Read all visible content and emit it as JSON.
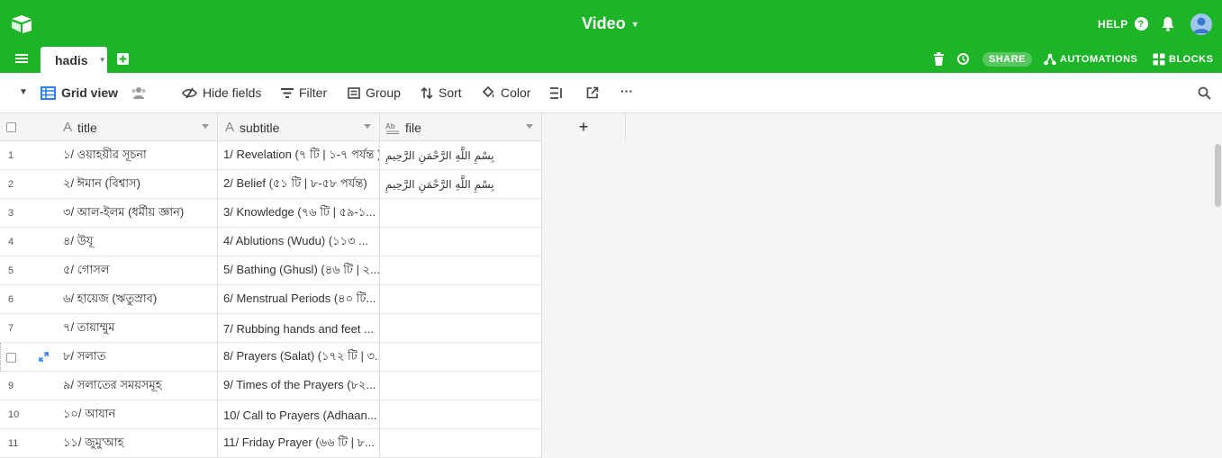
{
  "header": {
    "base_name": "Video",
    "help_label": "HELP",
    "share_label": "SHARE",
    "automations_label": "AUTOMATIONS",
    "blocks_label": "BLOCKS",
    "brand_color": "#1db428"
  },
  "tabs": [
    {
      "label": "hadis",
      "active": true
    }
  ],
  "viewbar": {
    "view_name": "Grid view",
    "hide_fields": "Hide fields",
    "filter": "Filter",
    "group": "Group",
    "sort": "Sort",
    "color": "Color",
    "more": "···"
  },
  "grid": {
    "columns": [
      {
        "name": "title",
        "type": "text"
      },
      {
        "name": "subtitle",
        "type": "text"
      },
      {
        "name": "file",
        "type": "rich-text"
      }
    ],
    "add_column": "+",
    "rows": [
      {
        "num": "1",
        "title": "১/ ওয়াহয়ীর সূচনা",
        "subtitle": "1/ Revelation (৭ টি | ১-৭ পর্যন্ত )",
        "file": "بِسْمِ اللَّهِ الرَّحْمَنِ الرَّحِيمِ"
      },
      {
        "num": "2",
        "title": "২/ ঈমান (বিশ্বাস)",
        "subtitle": "2/ Belief (৫১ টি | ৮-৫৮ পর্যন্ত)",
        "file": "بِسْمِ اللَّهِ الرَّحْمَنِ الرَّحِيمِ"
      },
      {
        "num": "3",
        "title": "৩/ আল-ইলম (ধর্মীয় জ্ঞান)",
        "subtitle": "3/ Knowledge (৭৬ টি | ৫৯-১...",
        "file": ""
      },
      {
        "num": "4",
        "title": "৪/ উযূ",
        "subtitle": "4/ Ablutions (Wudu) (১১৩ ...",
        "file": ""
      },
      {
        "num": "5",
        "title": "৫/ গোসল",
        "subtitle": "5/ Bathing (Ghusl) (৪৬ টি | ২...",
        "file": ""
      },
      {
        "num": "6",
        "title": "৬/ হায়েজ (ঋতুস্রাব)",
        "subtitle": "6/ Menstrual Periods (৪০ টি...",
        "file": ""
      },
      {
        "num": "7",
        "title": "৭/ তায়াম্মুম",
        "subtitle": "7/ Rubbing hands and feet ...",
        "file": ""
      },
      {
        "num": "",
        "title": "৮/ সলাত",
        "subtitle": "8/ Prayers (Salat) (১৭২ টি | ৩...",
        "file": "",
        "hover": true
      },
      {
        "num": "9",
        "title": "৯/ সলাতের সময়সমূহ",
        "subtitle": "9/ Times of the Prayers (৮২...",
        "file": ""
      },
      {
        "num": "10",
        "title": "১০/ আযান",
        "subtitle": "10/ Call to Prayers (Adhaan...",
        "file": ""
      },
      {
        "num": "11",
        "title": "১১/ জুমু'আহ",
        "subtitle": "11/ Friday Prayer (৬৬ টি | ৮...",
        "file": ""
      }
    ]
  }
}
